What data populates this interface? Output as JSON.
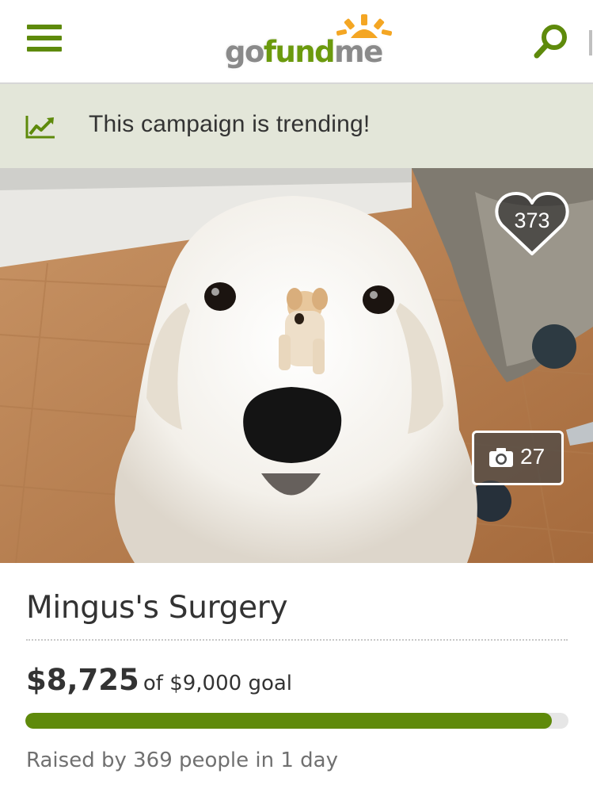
{
  "header": {
    "logo_text": [
      "go",
      "fund",
      "me"
    ],
    "menu_icon": "hamburger-menu-icon",
    "search_icon": "search-icon"
  },
  "trending": {
    "icon": "trending-up-icon",
    "text": "This campaign is trending!"
  },
  "photo": {
    "hearts_count": "373",
    "photos_count": "27"
  },
  "campaign": {
    "title": "Mingus's Surgery",
    "raised": "$8,725",
    "goal_text": "of $9,000 goal",
    "progress_fraction": 0.969,
    "raised_by": "Raised by 369 people in 1 day"
  },
  "colors": {
    "brand_green": "#5f8a0b",
    "trend_bar_bg": "#e3e6d9",
    "logo_sun": "#f4a623"
  }
}
